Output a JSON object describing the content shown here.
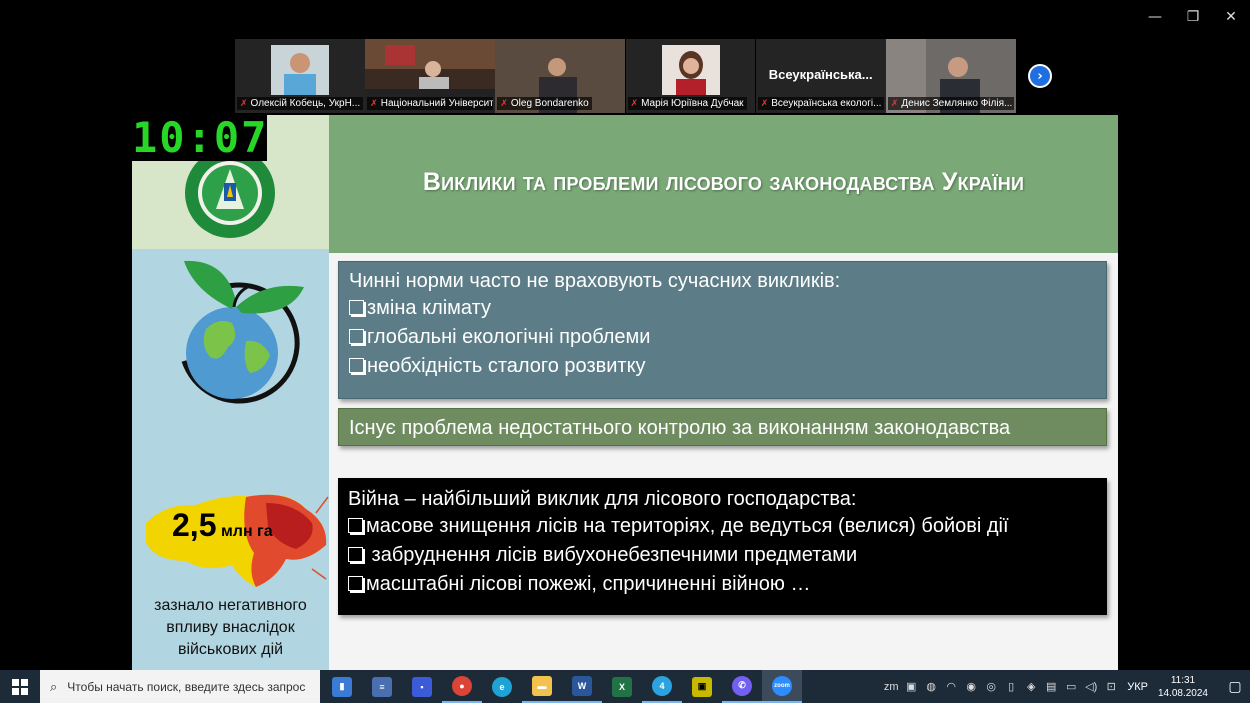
{
  "window": {
    "minimize_icon": "minimize-icon",
    "restore_icon": "restore-icon",
    "close_icon": "close-icon"
  },
  "participants": [
    {
      "name": "Олексій Кобець, УкрН...",
      "muted": true
    },
    {
      "name": "Національний Університ...",
      "muted": true,
      "active": true
    },
    {
      "name": "Oleg Bondarenko",
      "muted": true
    },
    {
      "name": "Марія Юріївна Дубчак",
      "muted": true
    },
    {
      "name": "Всеукраїнська екологі...",
      "muted": true,
      "display_name": "Всеукраїнська..."
    },
    {
      "name": "Денис Землянко Філія...",
      "muted": true
    }
  ],
  "timer": "10:07",
  "slide": {
    "title": "Виклики та проблеми лісового законодавства України",
    "box1": {
      "title": "Чинні норми часто не враховують сучасних викликів:",
      "items": [
        "зміна клімату",
        "глобальні екологічні проблеми",
        "необхідність сталого розвитку"
      ]
    },
    "box2": {
      "text": "Існує проблема недостатнього контролю за виконанням законодавства"
    },
    "box3": {
      "title": "Війна – найбільший виклик для лісового господарства:",
      "items": [
        "масове знищення лісів на територіях, де ведуться (велися) бойові дії",
        " забруднення лісів вибухонебезпечними предметами",
        "масштабні лісові пожежі, спричиненні війною …"
      ]
    },
    "area": {
      "number": "2,5",
      "unit": "млн га",
      "caption": "зазнало негативного впливу внаслідок військових дій"
    }
  },
  "taskbar": {
    "search_placeholder": "Чтобы начать поиск, введите здесь запрос",
    "telegram_badge": "4",
    "zoom_label": "zoom",
    "language": "УКР",
    "time": "11:31",
    "date": "14.08.2024"
  },
  "colors": {
    "title_bar": "#7aa877",
    "box1": "#5c7d87",
    "box2": "#6e8c60",
    "left_column": "#b2d6e1",
    "timer_green": "#27d627",
    "active_speaker": "#2fd08d"
  }
}
